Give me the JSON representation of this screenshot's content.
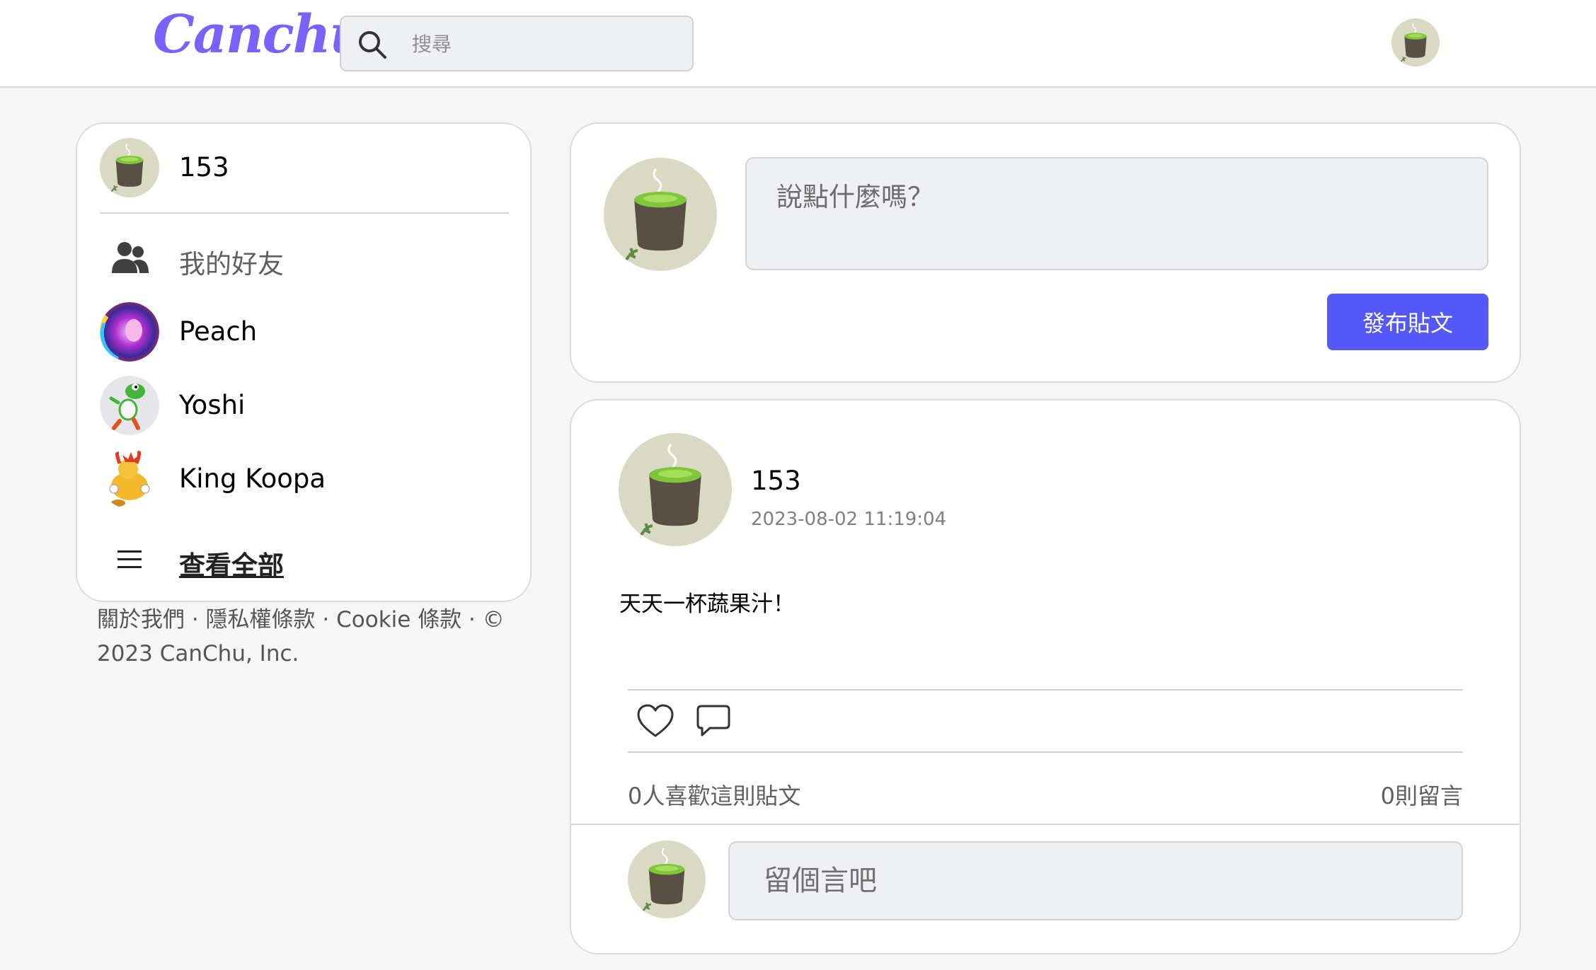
{
  "header": {
    "logo": "Canchu",
    "search_placeholder": "搜尋",
    "icons": {
      "search": "search-icon",
      "avatar": "user-avatar"
    }
  },
  "sidebar": {
    "profile_name": "153",
    "friends_label": "我的好友",
    "friends": [
      {
        "name": "Peach"
      },
      {
        "name": "Yoshi"
      },
      {
        "name": "King Koopa"
      }
    ],
    "view_all_label": "查看全部",
    "footer_text": "關於我們 · 隱私權條款 · Cookie 條款 · © 2023 CanChu, Inc."
  },
  "composer": {
    "placeholder": "說點什麼嗎？",
    "post_button": "發布貼文"
  },
  "post": {
    "author": "153",
    "timestamp": "2023-08-02 11:19:04",
    "content": "天天一杯蔬果汁！",
    "likes_text": "0人喜歡這則貼文",
    "comments_text": "0則留言",
    "comment_placeholder": "留個言吧"
  },
  "colors": {
    "brand": "#7763fb",
    "primary_button": "#5458f7",
    "background": "#f6f6f6",
    "input_bg": "#eff0f4"
  }
}
